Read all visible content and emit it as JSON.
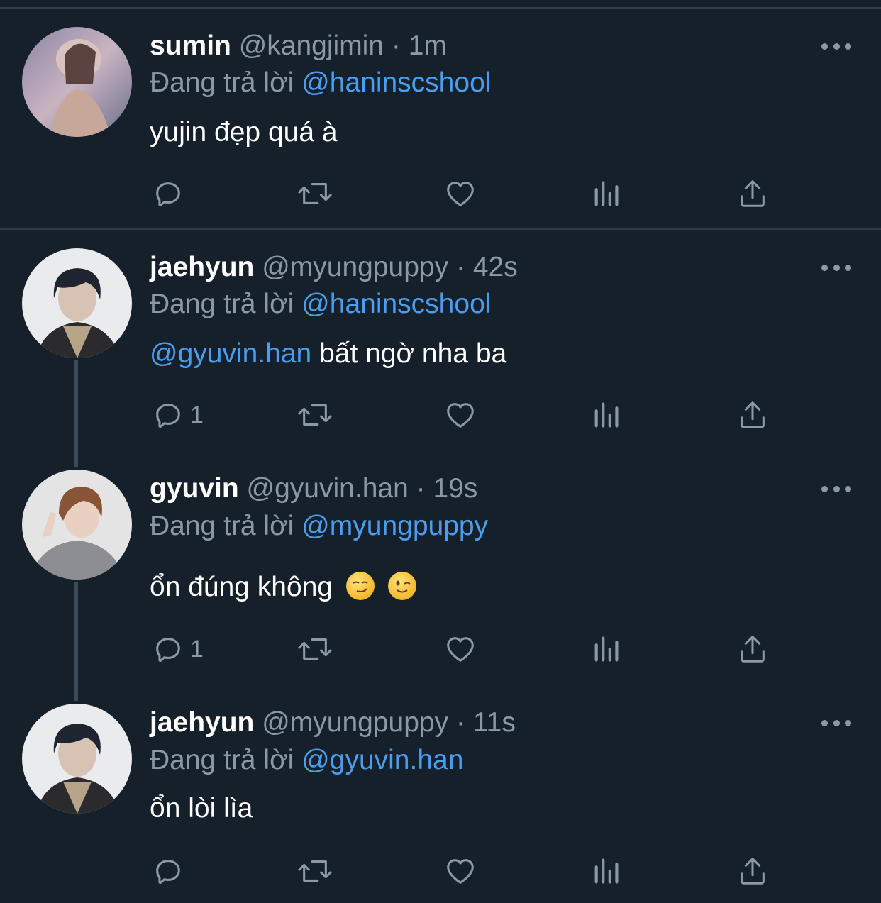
{
  "tweets": [
    {
      "display_name": "sumin",
      "handle": "@kangjimin",
      "dot": "·",
      "time": "1m",
      "reply_prefix": "Đang trả lời",
      "reply_to": "@haninscshool",
      "text": "yujin đẹp quá à",
      "reply_count": ""
    },
    {
      "display_name": "jaehyun",
      "handle": "@myungpuppy",
      "dot": "·",
      "time": "42s",
      "reply_prefix": "Đang trả lời",
      "reply_to": "@haninscshool",
      "text_mention": "@gyuvin.han",
      "text": "bất ngờ nha ba",
      "reply_count": "1"
    },
    {
      "display_name": "gyuvin",
      "handle": "@gyuvin.han",
      "dot": "·",
      "time": "19s",
      "reply_prefix": "Đang trả lời",
      "reply_to": "@myungpuppy",
      "text": "ổn đúng không",
      "emojis": [
        "smirking-face-emoji",
        "winking-face-emoji"
      ],
      "reply_count": "1"
    },
    {
      "display_name": "jaehyun",
      "handle": "@myungpuppy",
      "dot": "·",
      "time": "11s",
      "reply_prefix": "Đang trả lời",
      "reply_to": "@gyuvin.han",
      "text": "ổn lòi lìa",
      "reply_count": ""
    }
  ],
  "icons": {
    "reply": "reply-icon",
    "retweet": "retweet-icon",
    "like": "heart-icon",
    "views": "analytics-icon",
    "share": "share-icon",
    "more": "more-icon"
  },
  "colors": {
    "background": "#15202b",
    "text": "#ffffff",
    "secondary": "#8b98a5",
    "mention": "#4a9ef0",
    "divider": "#2f3b47"
  }
}
